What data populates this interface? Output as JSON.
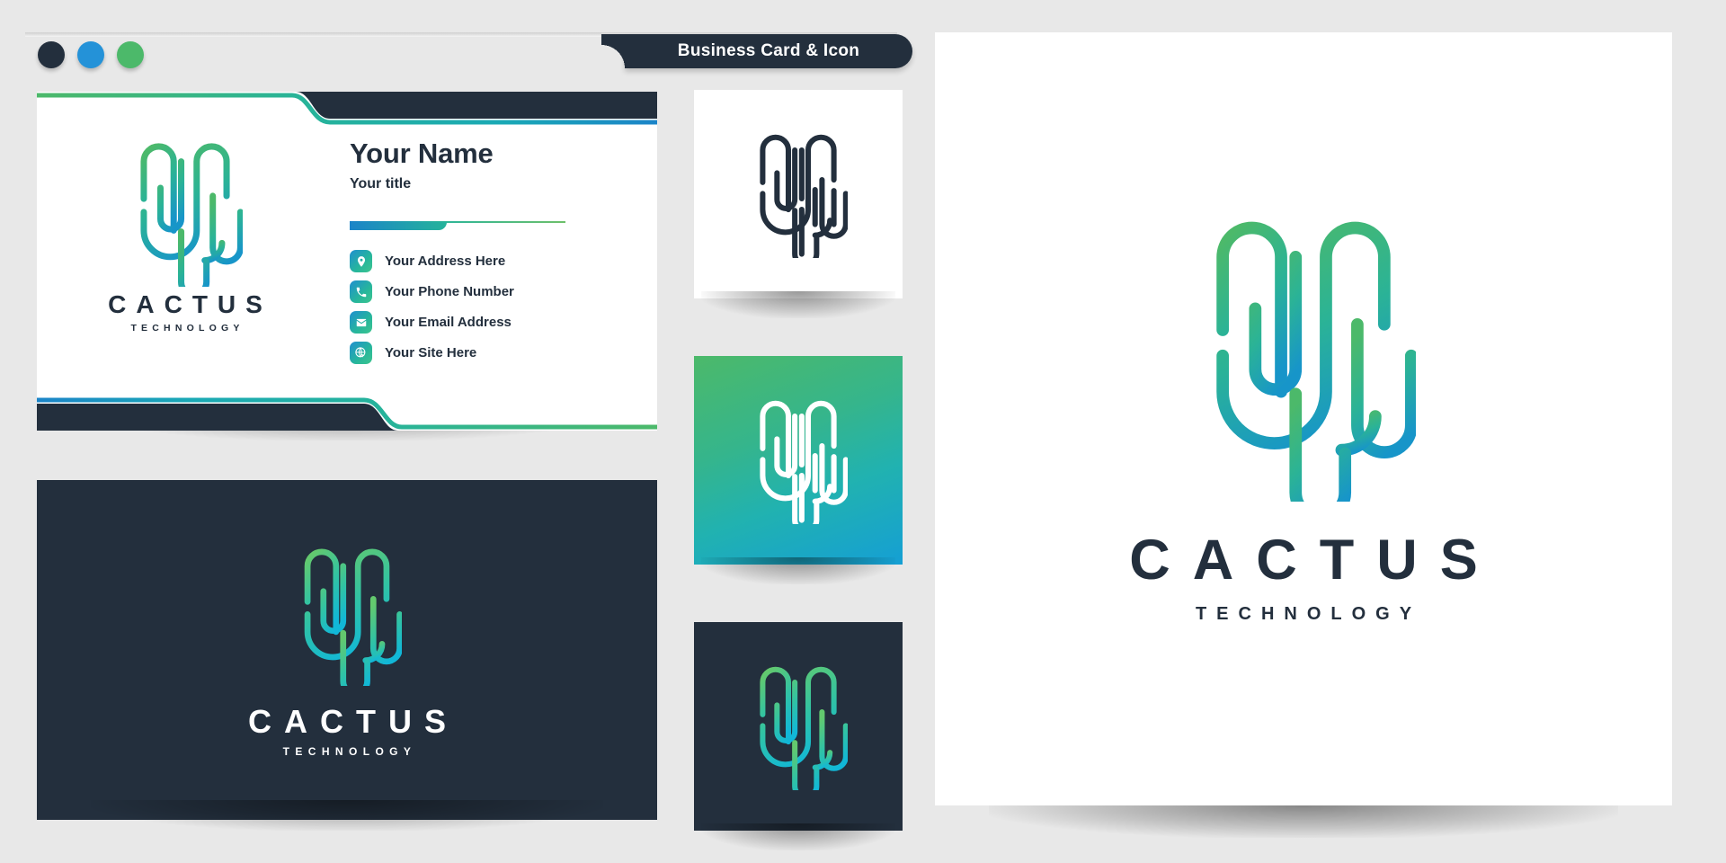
{
  "window": {
    "tab_title": "Business Card & Icon",
    "dots": [
      {
        "name": "close-dot",
        "color": "#232f3d"
      },
      {
        "name": "minimize-dot",
        "color": "#2492d8"
      },
      {
        "name": "maximize-dot",
        "color": "#4cb96a"
      }
    ]
  },
  "brand": {
    "name": "CACTUS",
    "tagline": "TECHNOLOGY",
    "logo_icon": "cactus-line-icon",
    "colors": {
      "dark": "#232f3d",
      "green": "#4cb96a",
      "teal": "#26b39b",
      "blue": "#159fd4",
      "white": "#ffffff"
    }
  },
  "card_front": {
    "person_name": "Your Name",
    "person_title": "Your title",
    "contacts": [
      {
        "icon": "location-pin-icon",
        "label": "Your Address Here"
      },
      {
        "icon": "phone-icon",
        "label": "Your Phone Number"
      },
      {
        "icon": "envelope-icon",
        "label": "Your Email Address"
      },
      {
        "icon": "globe-cursor-icon",
        "label": "Your Site Here"
      }
    ]
  },
  "card_back": {
    "name": "CACTUS",
    "tagline": "TECHNOLOGY"
  },
  "icon_variants": [
    {
      "name": "icon-variant-white",
      "background": "#ffffff",
      "mark_style": "dark"
    },
    {
      "name": "icon-variant-gradient",
      "background": "#35b58c",
      "mark_style": "white"
    },
    {
      "name": "icon-variant-dark",
      "background": "#232f3d",
      "mark_style": "gradient"
    }
  ],
  "big_logo": {
    "name": "CACTUS",
    "tagline": "TECHNOLOGY"
  }
}
